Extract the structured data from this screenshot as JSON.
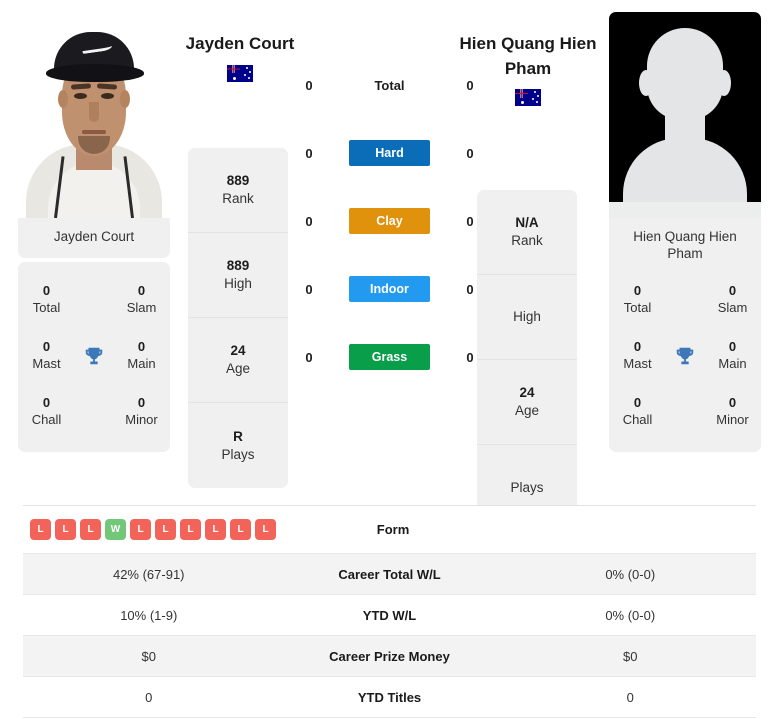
{
  "players": {
    "left": {
      "name": "Jayden Court",
      "photo_name": "Jayden Court",
      "flag": "australia-flag",
      "rank": "889",
      "rank_label": "Rank",
      "high": "889",
      "high_label": "High",
      "age": "24",
      "age_label": "Age",
      "plays": "R",
      "plays_label": "Plays",
      "titles": [
        {
          "value": "0",
          "label": "Total"
        },
        {
          "value": "0",
          "label": "Slam"
        },
        {
          "value": "0",
          "label": "Mast"
        },
        {
          "value": "0",
          "label": "Main"
        },
        {
          "value": "0",
          "label": "Chall"
        },
        {
          "value": "0",
          "label": "Minor"
        }
      ]
    },
    "right": {
      "name": "Hien Quang Hien Pham",
      "photo_name": "Hien Quang Hien Pham",
      "flag": "australia-flag",
      "rank": "N/A",
      "rank_label": "Rank",
      "high": "",
      "high_label": "High",
      "age": "24",
      "age_label": "Age",
      "plays": "",
      "plays_label": "Plays",
      "titles": [
        {
          "value": "0",
          "label": "Total"
        },
        {
          "value": "0",
          "label": "Slam"
        },
        {
          "value": "0",
          "label": "Mast"
        },
        {
          "value": "0",
          "label": "Main"
        },
        {
          "value": "0",
          "label": "Chall"
        },
        {
          "value": "0",
          "label": "Minor"
        }
      ]
    }
  },
  "surfaces": [
    {
      "label": "Total",
      "left": "0",
      "right": "0",
      "badge": false,
      "color": ""
    },
    {
      "label": "Hard",
      "left": "0",
      "right": "0",
      "badge": true,
      "color": "#0B6CB8"
    },
    {
      "label": "Clay",
      "left": "0",
      "right": "0",
      "badge": true,
      "color": "#E0920D"
    },
    {
      "label": "Indoor",
      "left": "0",
      "right": "0",
      "badge": true,
      "color": "#229AF0"
    },
    {
      "label": "Grass",
      "left": "0",
      "right": "0",
      "badge": true,
      "color": "#089E4A"
    }
  ],
  "comparison": [
    {
      "label": "Form",
      "type": "form",
      "left_form": [
        "L",
        "L",
        "L",
        "W",
        "L",
        "L",
        "L",
        "L",
        "L",
        "L"
      ],
      "right_form": [],
      "left": "",
      "right": ""
    },
    {
      "label": "Career Total W/L",
      "type": "text",
      "left": "42% (67-91)",
      "right": "0% (0-0)"
    },
    {
      "label": "YTD W/L",
      "type": "text",
      "left": "10% (1-9)",
      "right": "0% (0-0)"
    },
    {
      "label": "Career Prize Money",
      "type": "text",
      "left": "$0",
      "right": "$0"
    },
    {
      "label": "YTD Titles",
      "type": "text",
      "left": "0",
      "right": "0"
    }
  ],
  "icons": {
    "trophy": "trophy-icon",
    "trophy_color": "#3C78B8"
  }
}
